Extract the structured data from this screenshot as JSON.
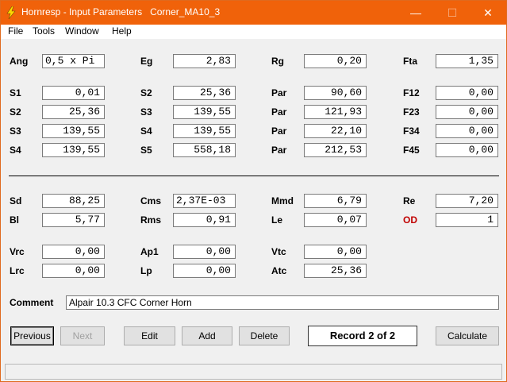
{
  "window": {
    "title": "Hornresp - Input Parameters   Corner_MA10_3",
    "minimize": "—",
    "maximize": "☐",
    "close": "✕"
  },
  "menu": [
    "File",
    "Tools",
    "Window",
    "Help"
  ],
  "params": {
    "ang": {
      "label": "Ang",
      "value": "0,5 x Pi"
    },
    "eg": {
      "label": "Eg",
      "value": "2,83"
    },
    "rg": {
      "label": "Rg",
      "value": "0,20"
    },
    "fta": {
      "label": "Fta",
      "value": "1,35"
    },
    "s1a": {
      "label": "S1",
      "value": "0,01"
    },
    "s2a": {
      "label": "S2",
      "value": "25,36"
    },
    "par1": {
      "label": "Par",
      "value": "90,60"
    },
    "f12": {
      "label": "F12",
      "value": "0,00"
    },
    "s2b": {
      "label": "S2",
      "value": "25,36"
    },
    "s3a": {
      "label": "S3",
      "value": "139,55"
    },
    "par2": {
      "label": "Par",
      "value": "121,93"
    },
    "f23": {
      "label": "F23",
      "value": "0,00"
    },
    "s3b": {
      "label": "S3",
      "value": "139,55"
    },
    "s4a": {
      "label": "S4",
      "value": "139,55"
    },
    "par3": {
      "label": "Par",
      "value": "22,10"
    },
    "f34": {
      "label": "F34",
      "value": "0,00"
    },
    "s4b": {
      "label": "S4",
      "value": "139,55"
    },
    "s5": {
      "label": "S5",
      "value": "558,18"
    },
    "par4": {
      "label": "Par",
      "value": "212,53"
    },
    "f45": {
      "label": "F45",
      "value": "0,00"
    },
    "sd": {
      "label": "Sd",
      "value": "88,25"
    },
    "cms": {
      "label": "Cms",
      "value": "2,37E-03"
    },
    "mmd": {
      "label": "Mmd",
      "value": "6,79"
    },
    "re": {
      "label": "Re",
      "value": "7,20"
    },
    "bl": {
      "label": "Bl",
      "value": "5,77"
    },
    "rms": {
      "label": "Rms",
      "value": "0,91"
    },
    "le": {
      "label": "Le",
      "value": "0,07"
    },
    "od": {
      "label": "OD",
      "value": "1"
    },
    "vrc": {
      "label": "Vrc",
      "value": "0,00"
    },
    "ap1": {
      "label": "Ap1",
      "value": "0,00"
    },
    "vtc": {
      "label": "Vtc",
      "value": "0,00"
    },
    "lrc": {
      "label": "Lrc",
      "value": "0,00"
    },
    "lp": {
      "label": "Lp",
      "value": "0,00"
    },
    "atc": {
      "label": "Atc",
      "value": "25,36"
    }
  },
  "comment": {
    "label": "Comment",
    "value": "Alpair 10.3 CFC Corner Horn"
  },
  "buttons": {
    "previous": "Previous",
    "next": "Next",
    "edit": "Edit",
    "add": "Add",
    "delete": "Delete",
    "calculate": "Calculate"
  },
  "record": "Record 2 of 2",
  "colors": {
    "titlebar": "#f0620a",
    "od_label": "#c00000"
  }
}
